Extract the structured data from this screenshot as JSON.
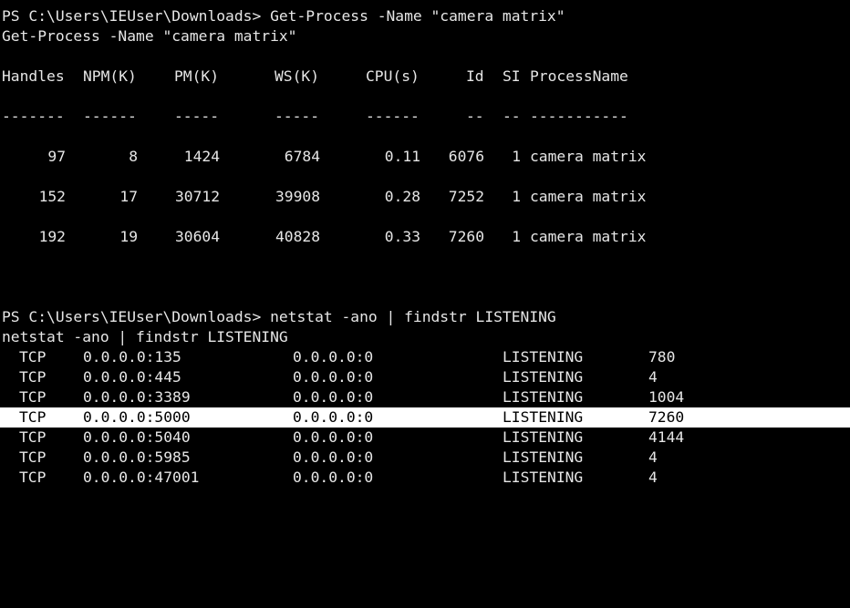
{
  "colors": {
    "background": "#000000",
    "foreground": "#e6e6e6",
    "highlight_background": "#ffffff",
    "highlight_foreground": "#000000"
  },
  "cmd1": {
    "prompt_line": "PS C:\\Users\\IEUser\\Downloads> Get-Process -Name \"camera matrix\"",
    "echo": "Get-Process -Name \"camera matrix\""
  },
  "process_table": {
    "headers": [
      "Handles",
      "NPM(K)",
      "PM(K)",
      "WS(K)",
      "CPU(s)",
      "Id",
      "SI",
      "ProcessName"
    ],
    "underlines": [
      "-------",
      "------",
      "-----",
      "-----",
      "------",
      "--",
      "--",
      "-----------"
    ],
    "rows": [
      [
        "97",
        "8",
        "1424",
        "6784",
        "0.11",
        "6076",
        "1",
        "camera matrix"
      ],
      [
        "152",
        "17",
        "30712",
        "39908",
        "0.28",
        "7252",
        "1",
        "camera matrix"
      ],
      [
        "192",
        "19",
        "30604",
        "40828",
        "0.33",
        "7260",
        "1",
        "camera matrix"
      ]
    ]
  },
  "cmd2": {
    "prompt_line": "PS C:\\Users\\IEUser\\Downloads> netstat -ano | findstr LISTENING",
    "echo": "netstat -ano | findstr LISTENING"
  },
  "netstat_rows": [
    [
      "TCP",
      "0.0.0.0:135",
      "0.0.0.0:0",
      "LISTENING",
      "780"
    ],
    [
      "TCP",
      "0.0.0.0:445",
      "0.0.0.0:0",
      "LISTENING",
      "4"
    ],
    [
      "TCP",
      "0.0.0.0:3389",
      "0.0.0.0:0",
      "LISTENING",
      "1004"
    ],
    [
      "TCP",
      "0.0.0.0:5000",
      "0.0.0.0:0",
      "LISTENING",
      "7260"
    ],
    [
      "TCP",
      "0.0.0.0:5040",
      "0.0.0.0:0",
      "LISTENING",
      "4144"
    ],
    [
      "TCP",
      "0.0.0.0:5985",
      "0.0.0.0:0",
      "LISTENING",
      "4"
    ],
    [
      "TCP",
      "0.0.0.0:47001",
      "0.0.0.0:0",
      "LISTENING",
      "4"
    ]
  ],
  "highlighted_netstat_row": 3
}
